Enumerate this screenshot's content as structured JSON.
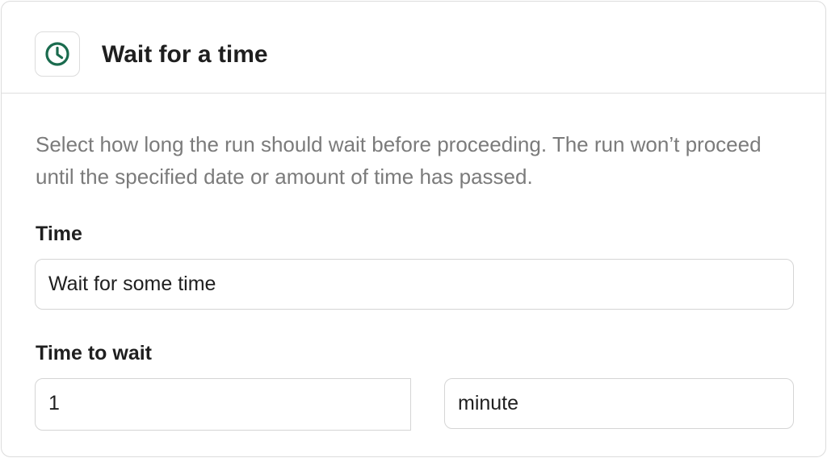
{
  "header": {
    "icon": "clock-icon",
    "title": "Wait for a time"
  },
  "description": "Select how long the run should wait before proceeding. The run won’t proceed until the specified date or amount of time has passed.",
  "time_field": {
    "label": "Time",
    "value": "Wait for some time"
  },
  "time_to_wait": {
    "label": "Time to wait",
    "amount": "1",
    "unit": "minute"
  },
  "colors": {
    "accent": "#1a6b4e",
    "border": "#dcdcdc",
    "muted_text": "#7b7b7b"
  }
}
